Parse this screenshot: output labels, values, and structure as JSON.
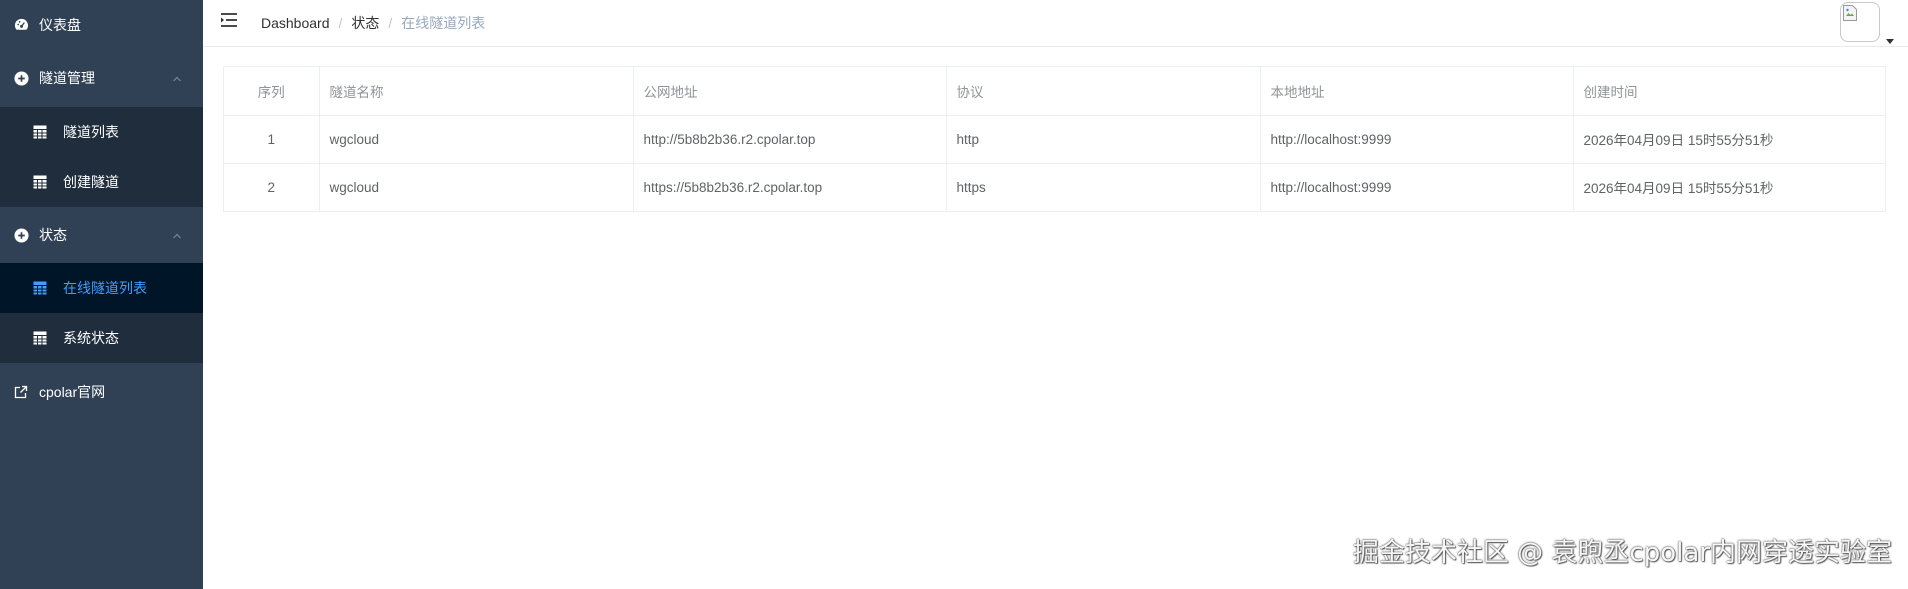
{
  "sidebar": {
    "dashboard_label": "仪表盘",
    "tunnel_mgmt": {
      "label": "隧道管理",
      "items": [
        {
          "label": "隧道列表"
        },
        {
          "label": "创建隧道"
        }
      ]
    },
    "status": {
      "label": "状态",
      "items": [
        {
          "label": "在线隧道列表"
        },
        {
          "label": "系统状态"
        }
      ]
    },
    "official_site_label": "cpolar官网",
    "colors": {
      "bg": "#304156",
      "submenu_bg": "#1f2d3d",
      "active_bg": "#001528",
      "active_text": "#409eff"
    }
  },
  "navbar": {
    "breadcrumb": [
      "Dashboard",
      "状态",
      "在线隧道列表"
    ]
  },
  "table": {
    "columns": [
      "序列",
      "隧道名称",
      "公网地址",
      "协议",
      "本地地址",
      "创建时间"
    ],
    "rows": [
      [
        "1",
        "wgcloud",
        "http://5b8b2b36.r2.cpolar.top",
        "http",
        "http://localhost:9999",
        "2026年04月09日 15时55分51秒"
      ],
      [
        "2",
        "wgcloud",
        "https://5b8b2b36.r2.cpolar.top",
        "https",
        "http://localhost:9999",
        "2026年04月09日 15时55分51秒"
      ]
    ]
  },
  "watermark": "掘金技术社区 @ 袁煦丞cpolar内网穿透实验室"
}
